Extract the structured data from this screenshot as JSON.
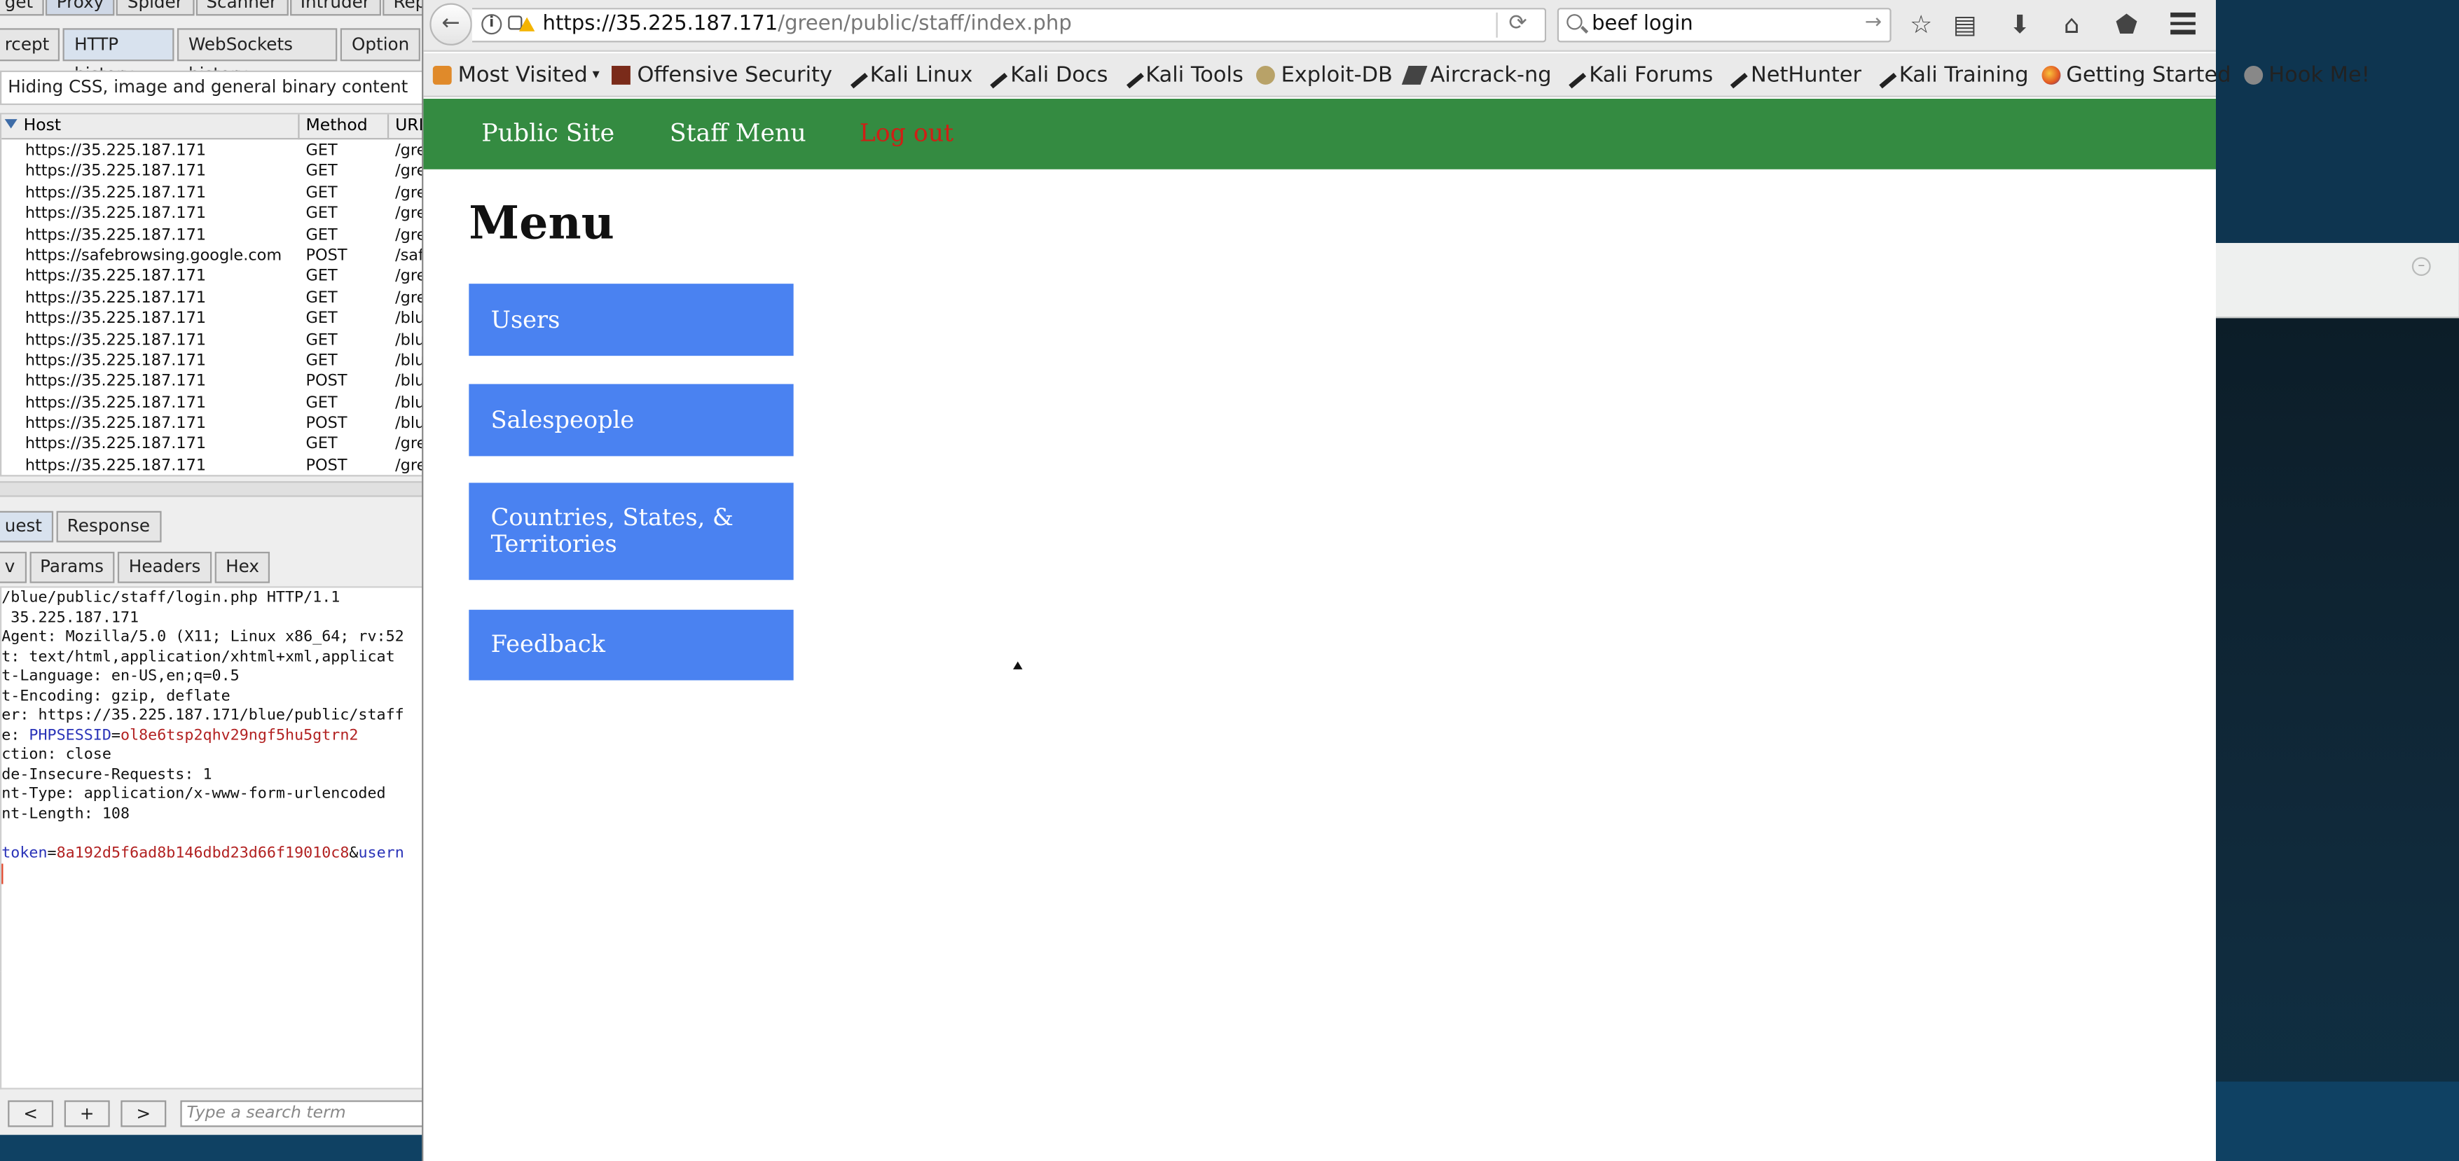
{
  "burp": {
    "top_tabs": [
      "get",
      "Proxy",
      "Spider",
      "Scanner",
      "Intruder",
      "Repeat"
    ],
    "proxy_tabs": [
      "rcept",
      "HTTP history",
      "WebSockets history",
      "Option"
    ],
    "filter_text": "Hiding CSS, image and general binary content",
    "columns": [
      "Host",
      "Method",
      "URL"
    ],
    "rows": [
      {
        "host": "https://35.225.187.171",
        "method": "GET",
        "url": "/gre"
      },
      {
        "host": "https://35.225.187.171",
        "method": "GET",
        "url": "/gre"
      },
      {
        "host": "https://35.225.187.171",
        "method": "GET",
        "url": "/gre"
      },
      {
        "host": "https://35.225.187.171",
        "method": "GET",
        "url": "/gre"
      },
      {
        "host": "https://35.225.187.171",
        "method": "GET",
        "url": "/gre"
      },
      {
        "host": "https://safebrowsing.google.com",
        "method": "POST",
        "url": "/saf"
      },
      {
        "host": "https://35.225.187.171",
        "method": "GET",
        "url": "/gre"
      },
      {
        "host": "https://35.225.187.171",
        "method": "GET",
        "url": "/gre"
      },
      {
        "host": "https://35.225.187.171",
        "method": "GET",
        "url": "/blu"
      },
      {
        "host": "https://35.225.187.171",
        "method": "GET",
        "url": "/blu"
      },
      {
        "host": "https://35.225.187.171",
        "method": "GET",
        "url": "/blu"
      },
      {
        "host": "https://35.225.187.171",
        "method": "POST",
        "url": "/blu"
      },
      {
        "host": "https://35.225.187.171",
        "method": "GET",
        "url": "/blu"
      },
      {
        "host": "https://35.225.187.171",
        "method": "POST",
        "url": "/blu"
      },
      {
        "host": "https://35.225.187.171",
        "method": "GET",
        "url": "/gre"
      },
      {
        "host": "https://35.225.187.171",
        "method": "POST",
        "url": "/gre"
      }
    ],
    "rr_tabs": [
      "uest",
      "Response"
    ],
    "view_tabs": [
      "v",
      "Params",
      "Headers",
      "Hex"
    ],
    "request_lines": {
      "l1": "/blue/public/staff/login.php HTTP/1.1",
      "l2": " 35.225.187.171",
      "l3": "Agent: Mozilla/5.0 (X11; Linux x86_64; rv:52",
      "l4": "t: text/html,application/xhtml+xml,applicat",
      "l5": "t-Language: en-US,en;q=0.5",
      "l6": "t-Encoding: gzip, deflate",
      "l7": "er: https://35.225.187.171/blue/public/staff",
      "l8_pre": "e: ",
      "l8_key": "PHPSESSID",
      "l8_eq": "=",
      "l8_val": "ol8e6tsp2qhv29ngf5hu5gtrn2",
      "l9": "ction: close",
      "l10": "de-Insecure-Requests: 1",
      "l11": "nt-Type: application/x-www-form-urlencoded",
      "l12": "nt-Length: 108",
      "l13_key": "token",
      "l13_eq": "=",
      "l13_val": "8a192d5f6ad8b146dbd23d66f19010c8",
      "l13_amp": "&",
      "l13_key2": "usern"
    },
    "nav_prev": "<",
    "nav_add": "+",
    "nav_next": ">",
    "search_placeholder": "Type a search term"
  },
  "firefox": {
    "url_host": "https://35.225.187.171",
    "url_path": "/green/public/staff/index.php",
    "search_value": "beef login",
    "bookmarks": [
      "Most Visited",
      "Offensive Security",
      "Kali Linux",
      "Kali Docs",
      "Kali Tools",
      "Exploit-DB",
      "Aircrack-ng",
      "Kali Forums",
      "NetHunter",
      "Kali Training",
      "Getting Started",
      "Hook Me!"
    ]
  },
  "site": {
    "nav": {
      "public_site": "Public Site",
      "staff_menu": "Staff Menu",
      "log_out": "Log out"
    },
    "title": "Menu",
    "menu_items": [
      "Users",
      "Salespeople",
      "Countries, States, & Territories",
      "Feedback"
    ],
    "colors": {
      "nav_bg": "#348b41",
      "menu_button": "#4a82f1",
      "logout": "#cf1f15"
    }
  }
}
